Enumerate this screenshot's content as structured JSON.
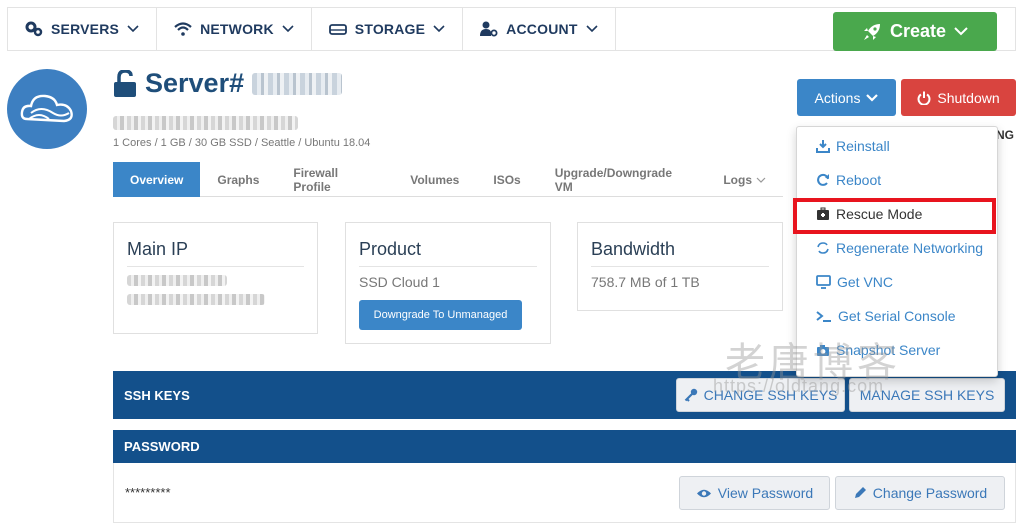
{
  "nav": {
    "items": [
      {
        "label": "SERVERS",
        "icon": "servers-gear-icon"
      },
      {
        "label": "NETWORK",
        "icon": "wifi-icon"
      },
      {
        "label": "STORAGE",
        "icon": "hard-drive-icon"
      },
      {
        "label": "ACCOUNT",
        "icon": "user-cog-icon"
      }
    ],
    "create_label": "Create"
  },
  "server": {
    "title": "Server#",
    "specs": "1 Cores / 1 GB / 30 GB SSD / Seattle / Ubuntu 18.04",
    "status_fragment": "NG"
  },
  "actions": {
    "actions_label": "Actions",
    "shutdown_label": "Shutdown",
    "menu": [
      {
        "label": "Reinstall",
        "icon": "download-icon"
      },
      {
        "label": "Reboot",
        "icon": "refresh-icon"
      },
      {
        "label": "Rescue Mode",
        "icon": "medkit-icon"
      },
      {
        "label": "Regenerate Networking",
        "icon": "sync-icon"
      },
      {
        "label": "Get VNC",
        "icon": "monitor-icon"
      },
      {
        "label": "Get Serial Console",
        "icon": "terminal-icon"
      },
      {
        "label": "Snapshot Server",
        "icon": "camera-icon"
      }
    ]
  },
  "tabs": [
    {
      "label": "Overview",
      "active": true
    },
    {
      "label": "Graphs"
    },
    {
      "label": "Firewall Profile"
    },
    {
      "label": "Volumes"
    },
    {
      "label": "ISOs"
    },
    {
      "label": "Upgrade/Downgrade VM"
    },
    {
      "label": "Logs"
    }
  ],
  "panels": {
    "main_ip": {
      "title": "Main IP"
    },
    "product": {
      "title": "Product",
      "value": "SSD Cloud 1",
      "button": "Downgrade To Unmanaged"
    },
    "bandwidth": {
      "title": "Bandwidth",
      "value": "758.7 MB of 1 TB"
    }
  },
  "ssh": {
    "title": "SSH KEYS",
    "change_label": "CHANGE SSH KEYS",
    "manage_label": "MANAGE SSH KEYS"
  },
  "password": {
    "title": "PASSWORD",
    "masked": "*********",
    "view_label": "View Password",
    "change_label": "Change Password"
  },
  "watermark": {
    "text": "老唐博客",
    "url": "https://oldtang.com"
  },
  "colors": {
    "primary": "#3b86c8",
    "nav_text": "#1f3a5f",
    "create": "#4aa84d",
    "shutdown": "#d9443f",
    "bar": "#13508b",
    "highlight": "#e8141e"
  }
}
